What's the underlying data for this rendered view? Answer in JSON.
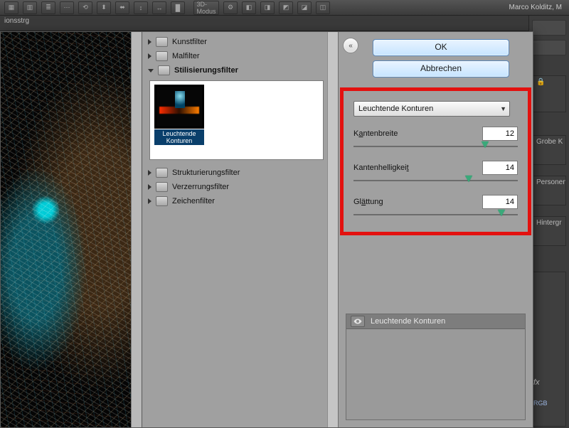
{
  "app": {
    "mode_3d_label": "3D-Modus",
    "user_tag": "Marco Kolditz, M",
    "optbar_tab": "ionsstrg"
  },
  "right_dark": {
    "pa": "",
    "pb": "Grobe K",
    "pc": "Personen",
    "pd": "Hintergr",
    "fx": "fx",
    "rgb": "RGB"
  },
  "dialog": {
    "buttons": {
      "ok": "OK",
      "cancel": "Abbrechen"
    },
    "collapse_glyph": "«",
    "tree": {
      "kunstfilter": "Kunstfilter",
      "malfilter": "Malfilter",
      "stilisierung": "Stilisierungsfilter",
      "struktur": "Strukturierungsfilter",
      "verzerrung": "Verzerrungsfilter",
      "zeichenfilter": "Zeichenfilter"
    },
    "thumb": {
      "label": "Leuchtende Konturen"
    },
    "combo": {
      "selected": "Leuchtende Konturen"
    },
    "params": {
      "p1": {
        "label_pre": "K",
        "label_u": "a",
        "label_post": "ntenbreite",
        "value": "12",
        "pos_pct": 80
      },
      "p2": {
        "label_pre": "Kantenhelligkei",
        "label_u": "t",
        "label_post": "",
        "value": "14",
        "pos_pct": 70
      },
      "p3": {
        "label_pre": "Gl",
        "label_u": "ä",
        "label_post": "ttung",
        "value": "14",
        "pos_pct": 90
      }
    },
    "stack": {
      "row1": "Leuchtende Konturen"
    }
  }
}
